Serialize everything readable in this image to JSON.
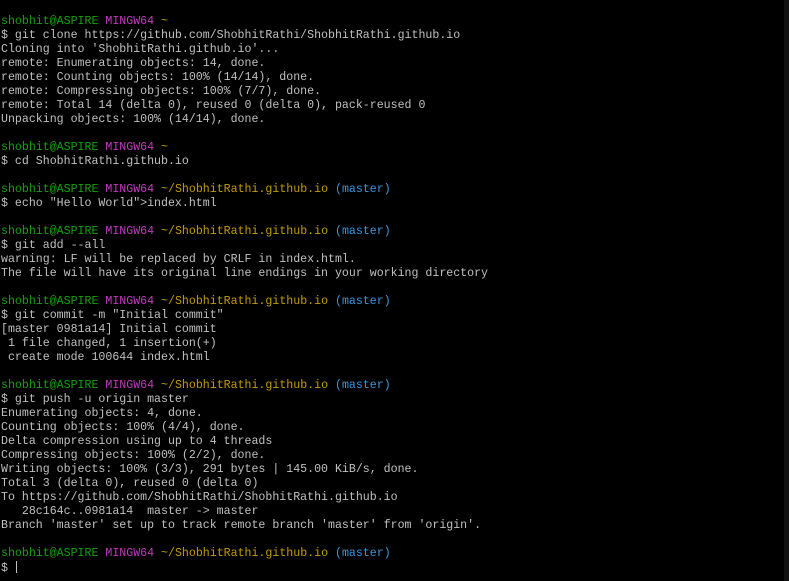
{
  "terminal": {
    "blocks": [
      {
        "prompt": {
          "user": "shobhit@ASPIRE",
          "env": "MINGW64",
          "path": "~",
          "branch": ""
        },
        "command": "$ git clone https://github.com/ShobhitRathi/ShobhitRathi.github.io",
        "output": [
          "Cloning into 'ShobhitRathi.github.io'...",
          "remote: Enumerating objects: 14, done.",
          "remote: Counting objects: 100% (14/14), done.",
          "remote: Compressing objects: 100% (7/7), done.",
          "remote: Total 14 (delta 0), reused 0 (delta 0), pack-reused 0",
          "Unpacking objects: 100% (14/14), done."
        ]
      },
      {
        "prompt": {
          "user": "shobhit@ASPIRE",
          "env": "MINGW64",
          "path": "~",
          "branch": ""
        },
        "command": "$ cd ShobhitRathi.github.io",
        "output": []
      },
      {
        "prompt": {
          "user": "shobhit@ASPIRE",
          "env": "MINGW64",
          "path": "~/ShobhitRathi.github.io",
          "branch": "(master)"
        },
        "command": "$ echo \"Hello World\">index.html",
        "output": []
      },
      {
        "prompt": {
          "user": "shobhit@ASPIRE",
          "env": "MINGW64",
          "path": "~/ShobhitRathi.github.io",
          "branch": "(master)"
        },
        "command": "$ git add --all",
        "output": [
          "warning: LF will be replaced by CRLF in index.html.",
          "The file will have its original line endings in your working directory"
        ]
      },
      {
        "prompt": {
          "user": "shobhit@ASPIRE",
          "env": "MINGW64",
          "path": "~/ShobhitRathi.github.io",
          "branch": "(master)"
        },
        "command": "$ git commit -m \"Initial commit\"",
        "output": [
          "[master 0981a14] Initial commit",
          " 1 file changed, 1 insertion(+)",
          " create mode 100644 index.html"
        ]
      },
      {
        "prompt": {
          "user": "shobhit@ASPIRE",
          "env": "MINGW64",
          "path": "~/ShobhitRathi.github.io",
          "branch": "(master)"
        },
        "command": "$ git push -u origin master",
        "output": [
          "Enumerating objects: 4, done.",
          "Counting objects: 100% (4/4), done.",
          "Delta compression using up to 4 threads",
          "Compressing objects: 100% (2/2), done.",
          "Writing objects: 100% (3/3), 291 bytes | 145.00 KiB/s, done.",
          "Total 3 (delta 0), reused 0 (delta 0)",
          "To https://github.com/ShobhitRathi/ShobhitRathi.github.io",
          "   28c164c..0981a14  master -> master",
          "Branch 'master' set up to track remote branch 'master' from 'origin'."
        ]
      },
      {
        "prompt": {
          "user": "shobhit@ASPIRE",
          "env": "MINGW64",
          "path": "~/ShobhitRathi.github.io",
          "branch": "(master)"
        },
        "command": "$ ",
        "output": [],
        "active": true
      }
    ],
    "colors": {
      "background": "#000000",
      "text": "#c0c0c0",
      "user": "#13a10e",
      "env": "#c239c2",
      "path": "#c19c00",
      "branch": "#3a96dd"
    }
  }
}
